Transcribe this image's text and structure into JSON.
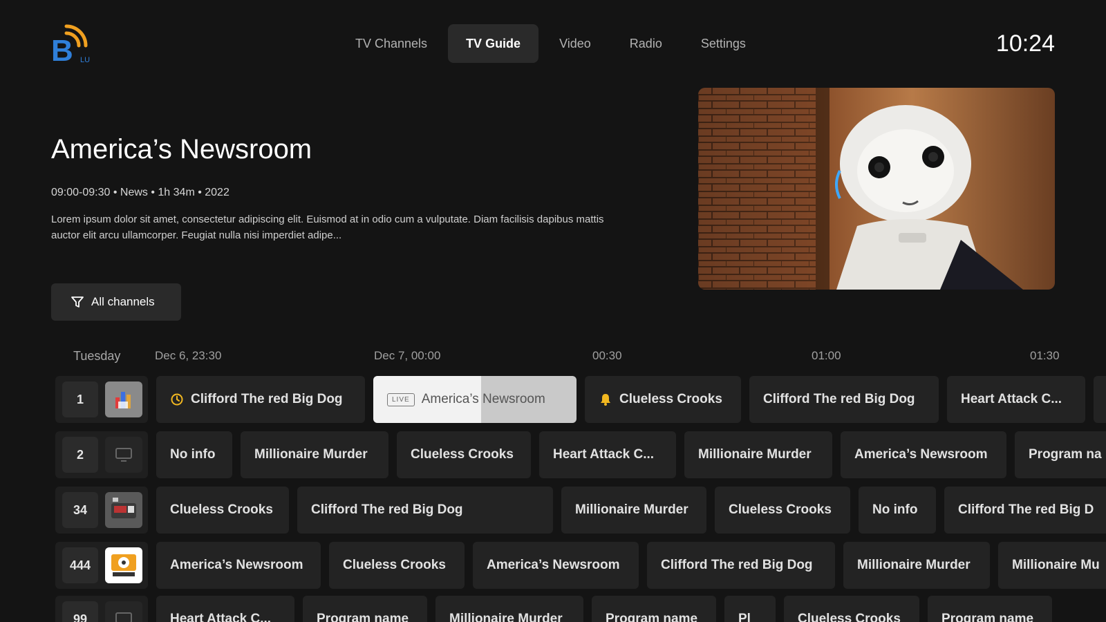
{
  "header": {
    "nav": [
      {
        "label": "TV Channels",
        "active": false
      },
      {
        "label": "TV Guide",
        "active": true
      },
      {
        "label": "Video",
        "active": false
      },
      {
        "label": "Radio",
        "active": false
      },
      {
        "label": "Settings",
        "active": false
      }
    ],
    "clock": "10:24",
    "logo_letter": "B",
    "logo_sub": "LU"
  },
  "hero": {
    "title": "America’s Newsroom",
    "meta": "09:00-09:30 • News  • 1h 34m • 2022",
    "description": "Lorem ipsum dolor sit amet, consectetur adipiscing elit. Euismod at in odio cum a vulputate. Diam facilisis dapibus mattis auctor elit arcu ullamcorper. Feugiat nulla nisi imperdiet adipe..."
  },
  "filter": {
    "label": "All channels",
    "icon": "filter-icon"
  },
  "timeline": {
    "day": "Tuesday",
    "times": [
      "Dec 6, 23:30",
      "Dec 7, 00:00",
      "00:30",
      "01:00",
      "01:30"
    ]
  },
  "colors": {
    "background": "#141414",
    "accent_blue": "#2f7fd9",
    "accent_orange": "#f0a020",
    "reminder_yellow": "#f2b820"
  },
  "rows": [
    {
      "channel": "1",
      "logo": "channel-1-logo",
      "programs": [
        {
          "title": "Clifford The red Big Dog",
          "icon": "clock-icon"
        },
        {
          "title": "America’s Newsroom",
          "live": "LIVE",
          "focused": true
        },
        {
          "title": "Clueless Crooks",
          "icon": "bell-icon"
        },
        {
          "title": "Clifford The red Big Dog"
        },
        {
          "title": "Heart Attack C..."
        },
        {
          "title": ""
        }
      ]
    },
    {
      "channel": "2",
      "logo": "monitor-icon",
      "programs": [
        {
          "title": "No info"
        },
        {
          "title": "Millionaire Murder"
        },
        {
          "title": "Clueless Crooks"
        },
        {
          "title": "Heart Attack C..."
        },
        {
          "title": "Millionaire Murder"
        },
        {
          "title": "America’s Newsroom"
        },
        {
          "title": "Program na"
        }
      ]
    },
    {
      "channel": "34",
      "logo": "channel-34-logo",
      "programs": [
        {
          "title": "Clueless Crooks"
        },
        {
          "title": "Clifford The red Big Dog"
        },
        {
          "title": "Millionaire Murder"
        },
        {
          "title": "Clueless Crooks"
        },
        {
          "title": "No info"
        },
        {
          "title": "Clifford The red Big D"
        }
      ]
    },
    {
      "channel": "444",
      "logo": "channel-444-logo",
      "programs": [
        {
          "title": "America’s Newsroom"
        },
        {
          "title": "Clueless Crooks"
        },
        {
          "title": "America’s Newsroom"
        },
        {
          "title": "Clifford The red Big Dog"
        },
        {
          "title": "Millionaire Murder"
        },
        {
          "title": "Millionaire Mu"
        }
      ]
    },
    {
      "channel": "99",
      "logo": "monitor-icon",
      "programs": [
        {
          "title": "Heart Attack C..."
        },
        {
          "title": "Program name"
        },
        {
          "title": "Millionaire Murder"
        },
        {
          "title": "Program name"
        },
        {
          "title": "Pl"
        },
        {
          "title": "Clueless Crooks"
        },
        {
          "title": "Program name"
        }
      ]
    }
  ]
}
